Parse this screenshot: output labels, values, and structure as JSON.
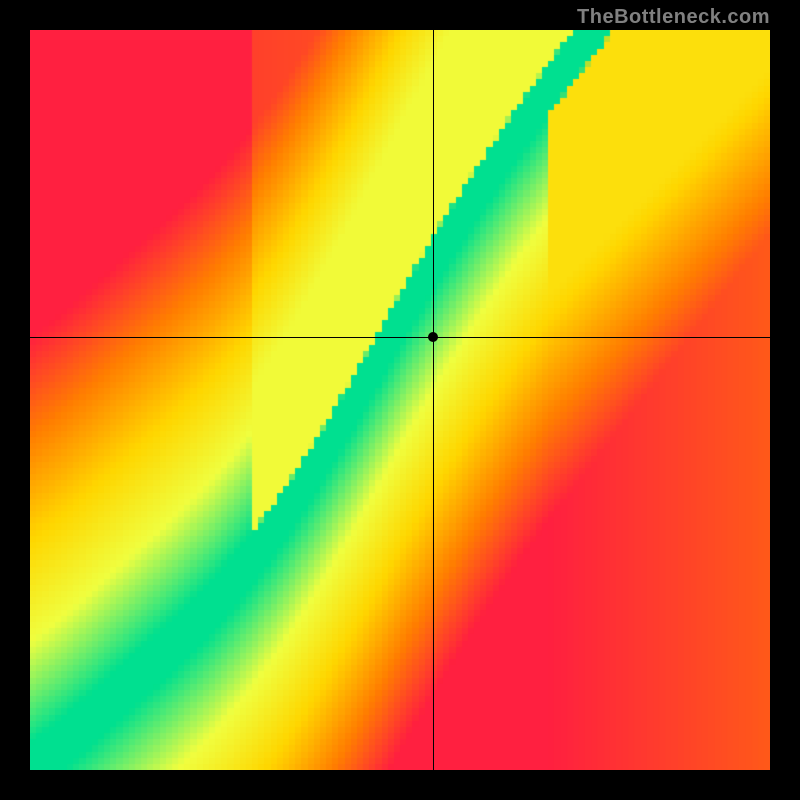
{
  "watermark": "TheBottleneck.com",
  "chart_data": {
    "type": "heatmap",
    "title": "",
    "xlabel": "",
    "ylabel": "",
    "xlim": [
      0,
      1
    ],
    "ylim": [
      0,
      1
    ],
    "crosshair": {
      "x": 0.545,
      "y": 0.585
    },
    "marker": {
      "x": 0.545,
      "y": 0.585
    },
    "optimal_curve": [
      {
        "x": 0.0,
        "y": 0.0
      },
      {
        "x": 0.05,
        "y": 0.04
      },
      {
        "x": 0.1,
        "y": 0.085
      },
      {
        "x": 0.15,
        "y": 0.13
      },
      {
        "x": 0.2,
        "y": 0.175
      },
      {
        "x": 0.25,
        "y": 0.225
      },
      {
        "x": 0.3,
        "y": 0.285
      },
      {
        "x": 0.35,
        "y": 0.355
      },
      {
        "x": 0.4,
        "y": 0.435
      },
      {
        "x": 0.45,
        "y": 0.52
      },
      {
        "x": 0.5,
        "y": 0.61
      },
      {
        "x": 0.55,
        "y": 0.695
      },
      {
        "x": 0.6,
        "y": 0.775
      },
      {
        "x": 0.65,
        "y": 0.85
      },
      {
        "x": 0.7,
        "y": 0.92
      },
      {
        "x": 0.75,
        "y": 0.985
      },
      {
        "x": 0.8,
        "y": 1.05
      }
    ],
    "band_width": 0.07,
    "colorscale": {
      "low": "#ff2040",
      "mid_low": "#ff8000",
      "mid": "#ffd700",
      "mid_high": "#f0ff40",
      "high": "#00e090"
    },
    "description": "Heatmap showing compatibility/fit along a diagonal S-curve. Green band indicates optimal match; colors transition through yellow and orange to red as distance from the optimal curve increases. A black crosshair and dot mark a specific (x, y) selection near the upper-middle of the plot, sitting on the right edge of the green band."
  }
}
